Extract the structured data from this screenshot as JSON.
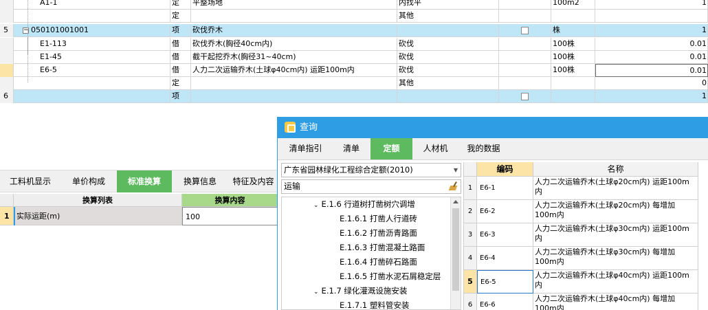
{
  "top_grid": {
    "rows": [
      {
        "num": "",
        "code": "A1-1",
        "type": "定",
        "name": "平整场地",
        "feature": "内找平",
        "unit": "100m2",
        "qty": "1",
        "highlight": false,
        "selected": false,
        "indent": 2
      },
      {
        "num": "",
        "code": "",
        "type": "定",
        "name": "",
        "feature": "其他",
        "unit": "",
        "qty": "",
        "highlight": false,
        "selected": false,
        "indent": 2
      },
      {
        "num": "5",
        "code": "050101001001",
        "type": "项",
        "name": "砍伐乔木",
        "feature": "",
        "unit": "株",
        "qty": "1",
        "highlight": true,
        "selected": false,
        "indent": 0,
        "checkbox": true,
        "collapse": "−"
      },
      {
        "num": "",
        "code": "E1-113",
        "type": "借",
        "name": "砍伐乔木(胸径40cm内)",
        "feature": "砍伐",
        "unit": "100株",
        "qty": "0.01",
        "highlight": false,
        "selected": false,
        "indent": 2
      },
      {
        "num": "",
        "code": "E1-45",
        "type": "借",
        "name": "截干起挖乔木(胸径31~40cm)",
        "feature": "砍伐",
        "unit": "100株",
        "qty": "0.01",
        "highlight": false,
        "selected": false,
        "indent": 2
      },
      {
        "num": "",
        "code": "E6-5",
        "type": "借",
        "name": "人力二次运输乔木(土球φ40cm内) 运距100m内",
        "feature": "砍伐",
        "unit": "100株",
        "qty": "0.01",
        "highlight": false,
        "selected": true,
        "indent": 2
      },
      {
        "num": "",
        "code": "",
        "type": "定",
        "name": "",
        "feature": "其他",
        "unit": "",
        "qty": "0",
        "highlight": false,
        "selected": false,
        "indent": 2
      },
      {
        "num": "6",
        "code": "",
        "type": "项",
        "name": "",
        "feature": "",
        "unit": "",
        "qty": "1",
        "highlight": true,
        "selected": false,
        "indent": 0,
        "checkbox": true
      }
    ]
  },
  "bottom_tabs": [
    "工料机显示",
    "单价构成",
    "标准换算",
    "换算信息",
    "特征及内容"
  ],
  "bottom_tabs_active": 2,
  "conversion": {
    "head_list": "换算列表",
    "head_content": "换算内容",
    "row_num": "1",
    "row_label": "实际运距(m)",
    "row_value": "100"
  },
  "dialog": {
    "title": "查询",
    "tabs": [
      "清单指引",
      "清单",
      "定额",
      "人材机",
      "我的数据"
    ],
    "active_tab": 2,
    "library": "广东省园林绿化工程综合定额(2010)",
    "search": "运输",
    "tree": [
      {
        "label": "E.1.6 行道树打凿树穴调增",
        "level": 1,
        "twist": "⌄"
      },
      {
        "label": "E.1.6.1 打凿人行道砖",
        "level": 2
      },
      {
        "label": "E.1.6.2 打凿沥青路面",
        "level": 2
      },
      {
        "label": "E.1.6.3 打凿混凝土路面",
        "level": 2
      },
      {
        "label": "E.1.6.4 打凿碎石路面",
        "level": 2
      },
      {
        "label": "E.1.6.5 打凿水泥石屑稳定层",
        "level": 2
      },
      {
        "label": "E.1.7 绿化灌溉设施安装",
        "level": 1,
        "twist": "⌄"
      },
      {
        "label": "E.1.7.1 塑料管安装",
        "level": 2
      }
    ],
    "results_head": {
      "code": "编码",
      "name": "名称"
    },
    "results": [
      {
        "n": "1",
        "code": "E6-1",
        "name": "人力二次运输乔木(土球φ20cm内) 运距100m内"
      },
      {
        "n": "2",
        "code": "E6-2",
        "name": "人力二次运输乔木(土球φ20cm内) 每增加100m内"
      },
      {
        "n": "3",
        "code": "E6-3",
        "name": "人力二次运输乔木(土球φ30cm内) 运距100m内"
      },
      {
        "n": "4",
        "code": "E6-4",
        "name": "人力二次运输乔木(土球φ30cm内) 每增加100m内"
      },
      {
        "n": "5",
        "code": "E6-5",
        "name": "人力二次运输乔木(土球φ40cm内) 运距100m内"
      },
      {
        "n": "6",
        "code": "E6-6",
        "name": "人力二次运输乔木(土球φ40cm内) 每增加100m内"
      }
    ],
    "results_selected": 4
  }
}
